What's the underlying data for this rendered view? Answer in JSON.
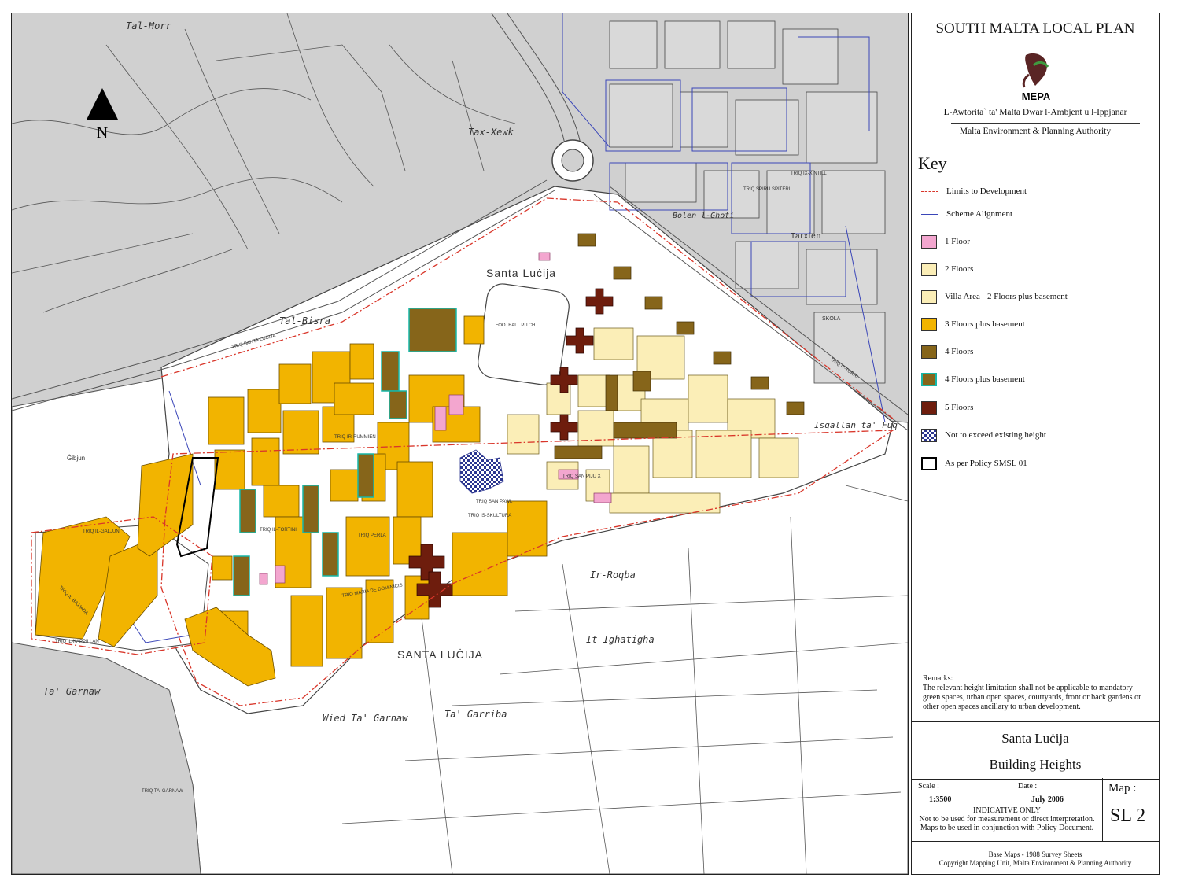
{
  "map": {
    "north_label": "N",
    "place_labels": [
      "Tal-Ħorr",
      "Tax-Xewk",
      "Tal-Bisra",
      "Santa Luċija",
      "SANTA LUĊIJA",
      "Ir-Roqba",
      "It-Ighatigħa",
      "Ta' Garnaw",
      "Ta' Garriba",
      "Wied Ta' Garnaw",
      "Tarxien",
      "Bolen l-Ghoti",
      "Isqallan ta' Fuq",
      "Ġibjun"
    ],
    "feature_labels": [
      "FOOTBALL PITCH",
      "SKOLA"
    ],
    "street_labels": [
      "TRIQ SAN PAWL",
      "TRIQ SANTA LUĊIJA",
      "TRIQ IL-FORTINI",
      "TRIQ IL-BAJJADA",
      "TRIQ IL-GALJUN",
      "TRIQ IR-RUMMIEN",
      "TRIQ MARIA DE DOMINICIS",
      "TRIQ SAN PIJU X",
      "TRIQ PERLA",
      "TRIQ IS-SKULTURA",
      "TRIQ IX-XINTILL",
      "TRIQ SPIRU SPITERI",
      "TRIQ IT-TORRI",
      "TRIQ TA' GARNAW",
      "TRIQ IL-KAPPILLAN"
    ]
  },
  "legend": {
    "plan_title": "SOUTH MALTA LOCAL PLAN",
    "logo_text": "MEPA",
    "authority_mt": "L-Awtorita` ta' Malta Dwar l-Ambjent u l-Ippjanar",
    "authority_en": "Malta Environment & Planning Authority",
    "key_heading": "Key",
    "items": [
      {
        "label": "Limits to Development",
        "kind": "dashdot",
        "color": "#d9362a"
      },
      {
        "label": "Scheme Alignment",
        "kind": "line",
        "color": "#3a46b8"
      },
      {
        "label": "1 Floor",
        "kind": "fill",
        "color": "#f3a6cf"
      },
      {
        "label": "2 Floors",
        "kind": "fill",
        "color": "#fbeeb7"
      },
      {
        "label": "Villa Area - 2 Floors plus basement",
        "kind": "fill",
        "color": "#fbeeb7"
      },
      {
        "label": "3 Floors plus basement",
        "kind": "fill",
        "color": "#f2b400"
      },
      {
        "label": "4 Floors",
        "kind": "fill",
        "color": "#86651a"
      },
      {
        "label": "4 Floors plus basement",
        "kind": "fill-outline",
        "color": "#86651a",
        "outline": "#17b7a8"
      },
      {
        "label": "5 Floors",
        "kind": "fill",
        "color": "#6e1d0d"
      },
      {
        "label": "Not to exceed existing height",
        "kind": "checker",
        "color": "#2b3590"
      },
      {
        "label": "As per Policy SMSL 01",
        "kind": "outline",
        "color": "#000000"
      }
    ],
    "remarks_title": "Remarks:",
    "remarks_text": "The relevant height limitation shall not be applicable to mandatory green spaces, urban open spaces, courtyards, front or back gardens or other open spaces ancillary to urban development.",
    "map_name": "Santa Luċija",
    "map_subject": "Building Heights",
    "scale_label": "Scale :",
    "scale_value": "1:3500",
    "date_label": "Date :",
    "date_value": "July 2006",
    "indicative_1": "INDICATIVE ONLY",
    "indicative_2": "Not to be used for measurement or direct interpretation.",
    "indicative_3": "Maps to be used in conjunction with Policy Document.",
    "map_label": "Map :",
    "map_number": "SL 2",
    "credits_1": "Base Maps - 1988 Survey Sheets",
    "credits_2": "Copyright Mapping Unit, Malta Environment & Planning Authority"
  }
}
